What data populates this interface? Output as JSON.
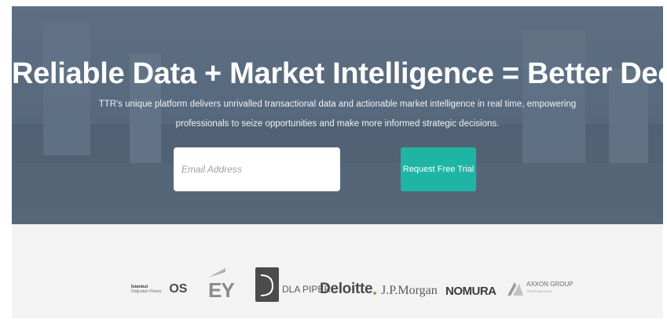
{
  "hero": {
    "title": "Reliable Data + Market Intelligence = Better Decisions",
    "subtitle_line1": "TTR's unique platform delivers unrivalled transactional data and actionable market intelligence in real time, empowering",
    "subtitle_line2": "professionals to seize opportunities and make more informed strategic decisions.",
    "email_placeholder": "Email Address",
    "cta_label": "Request Free Trial"
  },
  "logos": {
    "istanbul": {
      "line1": "İstanbul",
      "line2": "Doğrudan Finans",
      "mark": "OS"
    },
    "ey": "EY",
    "dla": "DLA PIPER",
    "deloitte": "Deloitte",
    "jpmorgan": "J.P.Morgan",
    "nomura": "NOMURA",
    "axxon": {
      "name": "AXXON GROUP",
      "tagline": "TRUST ANY DEAL"
    }
  },
  "colors": {
    "hero_bg": "#5e6f83",
    "cta_bg": "#1fb5a4",
    "band_bg": "#f3f3f3"
  }
}
